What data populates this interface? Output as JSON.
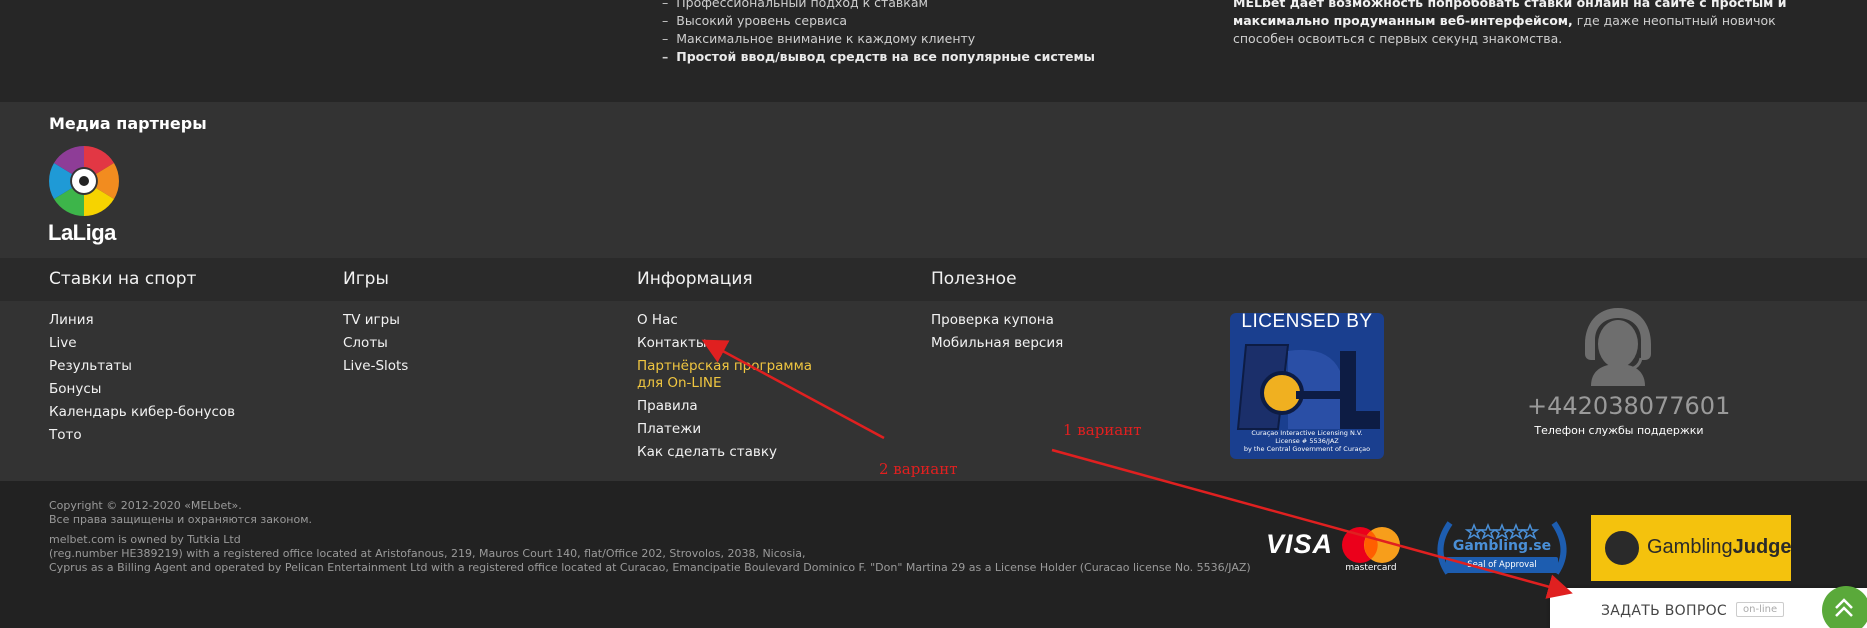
{
  "top": {
    "features": [
      {
        "text": "Профессиональный подход к ставкам",
        "bold": false
      },
      {
        "text": "Высокий уровень сервиса",
        "bold": false
      },
      {
        "text": "Максимальное внимание к каждому клиенту",
        "bold": false
      },
      {
        "text": "Простой ввод/вывод средств на все популярные системы",
        "bold": true
      }
    ],
    "desc_bold": "MELbet дает возможность попробовать ставки онлайн на сайте с простым и максимально продуманным веб-интерфейсом,",
    "desc_rest": " где даже неопытный новичок способен освоиться с первых секунд знакомства."
  },
  "media": {
    "title": "Медиа партнеры",
    "laliga": "LaLiga"
  },
  "columns": [
    {
      "title": "Ставки на спорт",
      "items": [
        "Линия",
        "Live",
        "Результаты",
        "Бонусы",
        "Календарь кибер-бонусов",
        "Тото"
      ]
    },
    {
      "title": "Игры",
      "items": [
        "TV игры",
        "Слоты",
        "Live-Slots"
      ]
    },
    {
      "title": "Информация",
      "items": [
        "О Нас",
        "Контакты",
        "Партнёрская программа для On-LINE",
        "Правила",
        "Платежи",
        "Как сделать ставку"
      ],
      "accent_index": 2
    },
    {
      "title": "Полезное",
      "items": [
        "Проверка купона",
        "Мобильная версия"
      ]
    }
  ],
  "license": {
    "header": "LICENSED BY",
    "line1": "Curaçao Interactive Licensing N.V.",
    "line2": "License # 5536/JAZ",
    "line3": "by the Central Government of Curaçao"
  },
  "support": {
    "phone": "+442038077601",
    "label": "Телефон службы поддержки"
  },
  "copyright": {
    "line1": "Copyright © 2012-2020 «MELbet».",
    "line2": "Все права защищены и охраняются законом.",
    "line3": "melbet.com is owned by Tutkia Ltd",
    "line4": "(reg.number HE389219) with a registered office located at Aristofanous, 219, Mauros Court 140, flat/Office 202, Strovolos, 2038, Nicosia,",
    "line5": "Cyprus as a Billing Agent and operated by Pelican Entertainment Ltd with a registered office located at Curacao, Emancipatie Boulevard Dominico F. \"Don\" Martina 29 as a License Holder (Curacao license No. 5536/JAZ)"
  },
  "payments": {
    "visa": "VISA",
    "mastercard": "mastercard",
    "gambling_se": "Gambling.se",
    "seal": "Seal of Approval",
    "gj_light": "Gambling",
    "gj_bold": "Judge"
  },
  "chat": {
    "label": "ЗАДАТЬ ВОПРОС",
    "status": "on-line"
  },
  "annotations": {
    "variant1": "1 вариант",
    "variant2": "2 вариант"
  },
  "colors": {
    "accent_link": "#f0c640",
    "annotation": "#e02020",
    "chat_green": "#5aa93a"
  }
}
